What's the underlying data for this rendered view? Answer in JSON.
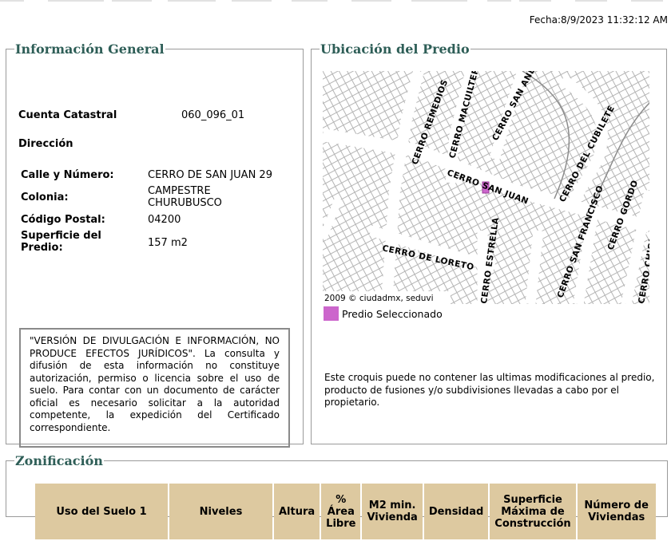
{
  "fecha": "Fecha:8/9/2023 11:32:12 AM",
  "general": {
    "legend": "Información General",
    "cuenta_label": "Cuenta Catastral",
    "cuenta_value": "060_096_01",
    "direccion_label": "Dirección",
    "calle_label": "Calle y Número:",
    "calle_value": "CERRO DE SAN JUAN 29",
    "colonia_label": "Colonia:",
    "colonia_value": "CAMPESTRE CHURUBUSCO",
    "cp_label": "Código Postal:",
    "cp_value": "04200",
    "superficie_label": "Superficie del Predio:",
    "superficie_value": "157 m2",
    "disclaimer": "\"VERSIÓN DE DIVULGACIÓN E INFORMACIÓN, NO PRODUCE EFECTOS JURÍDICOS\". La consulta y difusión de esta información no constituye autorización, permiso o licencia sobre el uso de suelo. Para contar con un documento de carácter oficial es necesario solicitar a la autoridad competente, la expedición del Certificado correspondiente."
  },
  "ubicacion": {
    "legend": "Ubicación del Predio",
    "credit": "2009 © ciudadmx, seduvi",
    "seleccionado_label": "Predio Seleccionado",
    "seleccionado_color": "#cc66cc",
    "croquis_note": "Este croquis puede no contener las ultimas modificaciones al predio, producto de fusiones y/o subdivisiones llevadas a cabo por el propietario.",
    "streets": {
      "remedios": "CERRO REMEDIOS",
      "macuiltepec": "CERRO MACUILTEPEC",
      "san_andres": "CERRO SAN ANDRES",
      "cubilete": "CERRO DEL CUBILETE",
      "san_juan": "CERRO SAN JUAN",
      "loreto": "CERRO DE LORETO",
      "estrella": "CERRO ESTRELLA",
      "san_francisco": "CERRO SAN FRANCISCO",
      "gordo": "CERRO GORDO",
      "chiquihuite": "CERRO CHIQUIHUITE"
    }
  },
  "zonificacion": {
    "legend": "Zonificación",
    "headers": [
      "Uso del Suelo 1",
      "Niveles",
      "Altura",
      "% Área Libre",
      "M2 min. Vivienda",
      "Densidad",
      "Superficie Máxima de Construcción",
      "Número de Viviendas"
    ]
  }
}
